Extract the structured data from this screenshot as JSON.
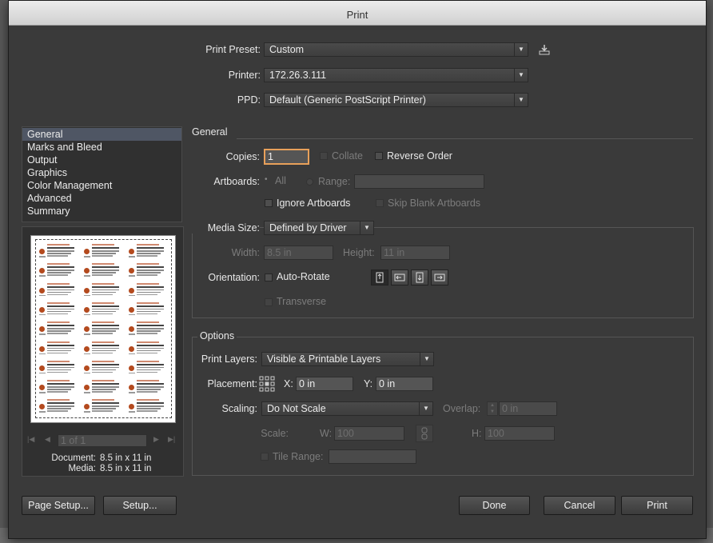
{
  "window": {
    "title": "Print"
  },
  "top": {
    "preset_label": "Print Preset:",
    "preset_value": "Custom",
    "printer_label": "Printer:",
    "printer_value": "172.26.3.111",
    "ppd_label": "PPD:",
    "ppd_value": "Default (Generic PostScript Printer)"
  },
  "sidebar": {
    "items": [
      {
        "label": "General",
        "selected": true
      },
      {
        "label": "Marks and Bleed"
      },
      {
        "label": "Output"
      },
      {
        "label": "Graphics"
      },
      {
        "label": "Color Management"
      },
      {
        "label": "Advanced"
      },
      {
        "label": "Summary"
      }
    ]
  },
  "preview": {
    "page_field": "1 of 1",
    "document_label": "Document:",
    "document_value": "8.5 in x 11 in",
    "media_label": "Media:",
    "media_value": "8.5 in x 11 in"
  },
  "general": {
    "heading": "General",
    "copies_label": "Copies:",
    "copies_value": "1",
    "collate_label": "Collate",
    "reverse_label": "Reverse Order",
    "artboards_label": "Artboards:",
    "all_label": "All",
    "range_label": "Range:",
    "ignore_label": "Ignore Artboards",
    "skip_label": "Skip Blank Artboards"
  },
  "media": {
    "size_label": "Media Size:",
    "size_value": "Defined by Driver",
    "width_label": "Width:",
    "width_value": "8.5 in",
    "height_label": "Height:",
    "height_value": "11 in",
    "orientation_label": "Orientation:",
    "autorotate_label": "Auto-Rotate",
    "transverse_label": "Transverse"
  },
  "options": {
    "heading": "Options",
    "layers_label": "Print Layers:",
    "layers_value": "Visible & Printable Layers",
    "placement_label": "Placement:",
    "x_label": "X:",
    "x_value": "0 in",
    "y_label": "Y:",
    "y_value": "0 in",
    "scaling_label": "Scaling:",
    "scaling_value": "Do Not Scale",
    "overlap_label": "Overlap:",
    "overlap_value": "0 in",
    "scale_label": "Scale:",
    "w_label": "W:",
    "w_value": "100",
    "h_label": "H:",
    "h_value": "100",
    "tile_label": "Tile Range:"
  },
  "buttons": {
    "page_setup": "Page Setup...",
    "setup": "Setup...",
    "done": "Done",
    "cancel": "Cancel",
    "print": "Print"
  },
  "colors": {
    "selection": "#4f5664",
    "dialog_bg": "#3a3a3a",
    "copies_focus": "#e8a05a"
  }
}
